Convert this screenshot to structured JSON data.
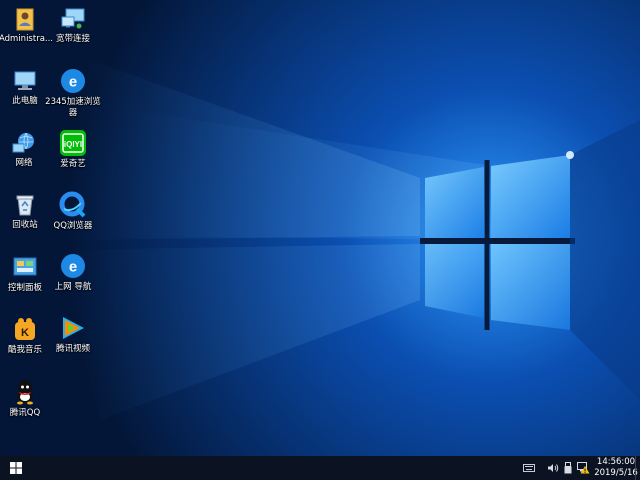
{
  "desktop": {
    "icons": [
      {
        "label": "Administra...",
        "icon": "user-folder-icon"
      },
      {
        "label": "宽带连接",
        "icon": "broadband-connection-icon"
      },
      {
        "label": "此电脑",
        "icon": "this-pc-icon"
      },
      {
        "label": "2345加速浏览器",
        "icon": "2345-browser-icon"
      },
      {
        "label": "网络",
        "icon": "network-icon"
      },
      {
        "label": "爱奇艺",
        "icon": "iqiyi-icon"
      },
      {
        "label": "回收站",
        "icon": "recycle-bin-icon"
      },
      {
        "label": "QQ浏览器",
        "icon": "qq-browser-icon"
      },
      {
        "label": "控制面板",
        "icon": "control-panel-icon"
      },
      {
        "label": "上网 导航",
        "icon": "web-navigation-icon"
      },
      {
        "label": "酷我音乐",
        "icon": "kuwo-music-icon"
      },
      {
        "label": "腾讯视频",
        "icon": "tencent-video-icon"
      },
      {
        "label": "腾讯QQ",
        "icon": "tencent-qq-icon"
      }
    ]
  },
  "taskbar": {
    "clock_time": "14:56:00",
    "clock_date": "2019/5/16",
    "tray_icons": [
      "keyboard-icon",
      "volume-icon",
      "usb-icon",
      "network-status-icon"
    ]
  },
  "colors": {
    "wallpaper_dark": "#041a45",
    "wallpaper_light": "#2f9bff",
    "taskbar": "#0b1222"
  }
}
